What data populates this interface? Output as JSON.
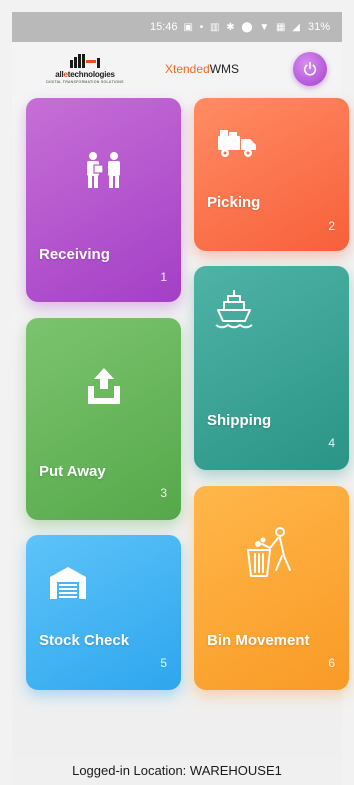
{
  "status_bar": {
    "time": "15:46",
    "icons": "▣ • ▥ ✱ ⬤ ▼ ▦ ◢",
    "battery": "31%"
  },
  "header": {
    "logo_text_prefix": "all",
    "logo_text_accent": "e",
    "logo_text_suffix": "technologies",
    "logo_subtitle": "DIGITAL TRANSFORMATION SOLUTIONS",
    "brand_accent": "Xtended",
    "brand_rest": "WMS",
    "power_icon": "power-icon"
  },
  "tiles": [
    {
      "id": "receiving",
      "label": "Receiving",
      "number": "1",
      "color": "#b354cc",
      "icon": "receiving-icon"
    },
    {
      "id": "picking",
      "label": "Picking",
      "number": "2",
      "color": "#f9714a",
      "icon": "truck-icon"
    },
    {
      "id": "putaway",
      "label": "Put Away",
      "number": "3",
      "color": "#65b55a",
      "icon": "upload-icon"
    },
    {
      "id": "shipping",
      "label": "Shipping",
      "number": "4",
      "color": "#35a394",
      "icon": "ship-icon"
    },
    {
      "id": "stock",
      "label": "Stock Check",
      "number": "5",
      "color": "#45b5f3",
      "icon": "warehouse-icon"
    },
    {
      "id": "bin",
      "label": "Bin Movement",
      "number": "6",
      "color": "#fca93a",
      "icon": "trash-icon"
    }
  ],
  "footer": {
    "location_text": "Logged-in Location: WAREHOUSE1"
  }
}
